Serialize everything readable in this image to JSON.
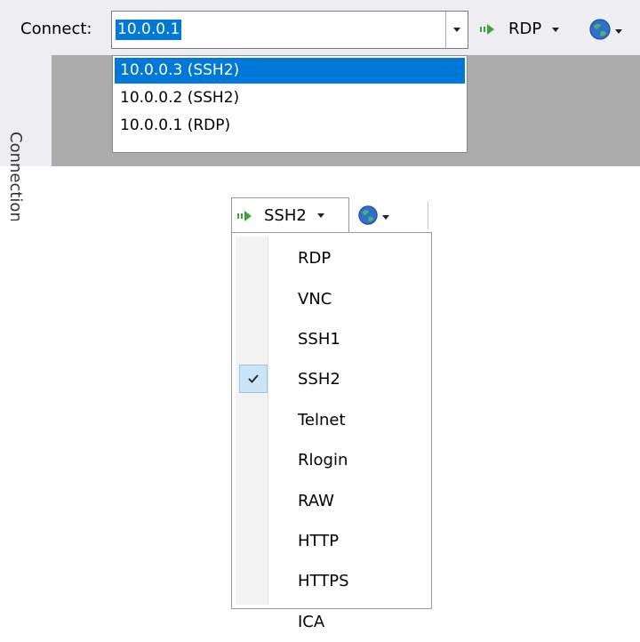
{
  "toolbar": {
    "connect_label": "Connect:",
    "address_value": "10.0.0.1",
    "protocol_label": "RDP",
    "side_panel_label": "Connections"
  },
  "address_dropdown": {
    "items": [
      "10.0.0.3 (SSH2)",
      "10.0.0.2 (SSH2)",
      "10.0.0.1 (RDP)"
    ],
    "selected_index": 0
  },
  "protocol_menu": {
    "button_label": "SSH2",
    "items": [
      "RDP",
      "VNC",
      "SSH1",
      "SSH2",
      "Telnet",
      "Rlogin",
      "RAW",
      "HTTP",
      "HTTPS",
      "ICA"
    ],
    "checked": "SSH2"
  },
  "icons": {
    "connect": "connect-arrow-icon",
    "globe": "globe-icon",
    "dropdown": "chevron-down-icon",
    "check": "checkmark-icon"
  },
  "colors": {
    "selection": "#0078d7",
    "check_highlight": "#cce4f7",
    "arrow_green": "#3aa63a",
    "toolbar_bg": "#eeeef2",
    "panel_gray": "#acacac"
  }
}
